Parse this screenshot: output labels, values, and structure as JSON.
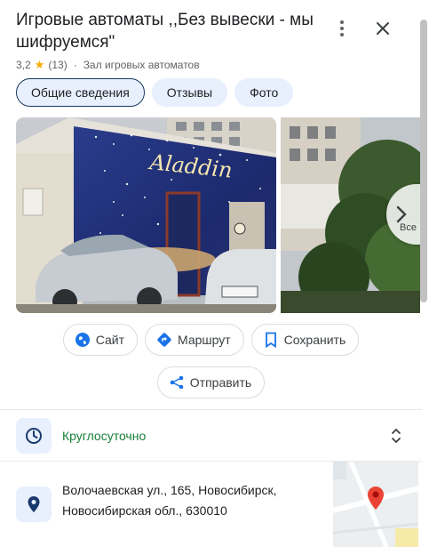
{
  "place": {
    "title": "Игровые автоматы ,,Без вывески - мы шифруемся\"",
    "rating": "3,2",
    "review_count": "(13)",
    "category": "Зал игровых автоматов"
  },
  "tabs": [
    {
      "label": "Общие сведения",
      "active": true
    },
    {
      "label": "Отзывы",
      "active": false
    },
    {
      "label": "Фото",
      "active": false
    }
  ],
  "photos": {
    "sign_text": "Aladdin",
    "more_label": "Все"
  },
  "actions": {
    "website": "Сайт",
    "route": "Маршрут",
    "save": "Сохранить",
    "share": "Отправить"
  },
  "hours": {
    "status": "Круглосуточно"
  },
  "address": {
    "line1": "Волочаевская ул., 165, Новосибирск,",
    "line2": "Новосибирская обл., 630010"
  },
  "colors": {
    "accent": "#1a73e8",
    "open_green": "#188038",
    "pin_red": "#ea4335"
  }
}
